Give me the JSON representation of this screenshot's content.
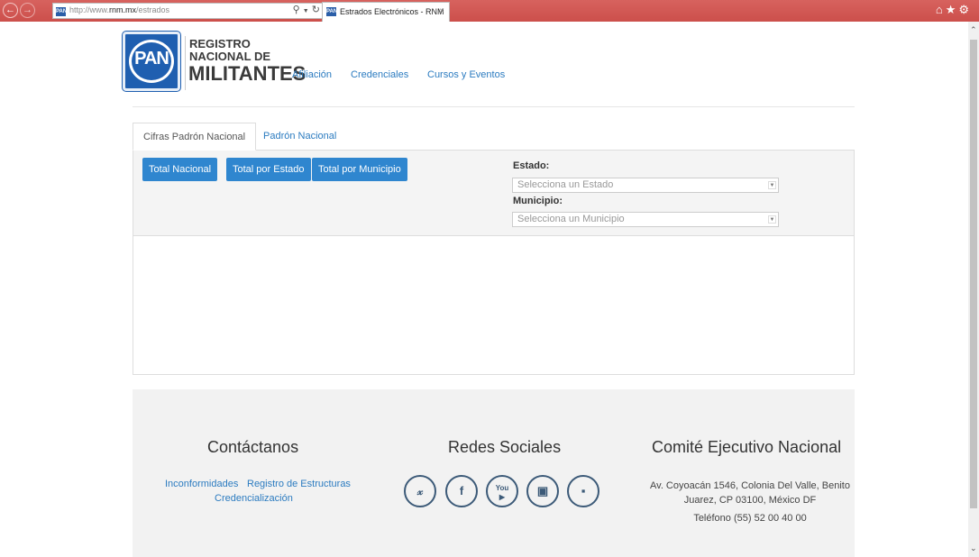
{
  "browser": {
    "url_prefix": "http://www.",
    "url_domain": "rnm.mx",
    "url_path": "/estrados",
    "tab_title": "Estrados Electrónicos - RNM",
    "favicon_text": "PAN"
  },
  "header": {
    "logo_text": "PAN",
    "brand_line1": "REGISTRO",
    "brand_line2": "NACIONAL DE",
    "brand_line3": "MILITANTES",
    "nav": [
      "Afiliación",
      "Credenciales",
      "Cursos y Eventos"
    ]
  },
  "tabs": {
    "active": "Cifras Padrón Nacional",
    "other": "Padrón Nacional"
  },
  "panel": {
    "buttons": [
      "Total Nacional",
      "Total por Estado",
      "Total por Municipio"
    ],
    "estado_label": "Estado:",
    "estado_placeholder": "Selecciona un Estado",
    "municipio_label": "Municipio:",
    "municipio_placeholder": "Selecciona un Municipio"
  },
  "footer": {
    "contact_title": "Contáctanos",
    "contact_links": [
      "Inconformidades",
      "Registro de Estructuras",
      "Credencialización"
    ],
    "social_title": "Redes Sociales",
    "social_icons": [
      "twitter-icon",
      "facebook-icon",
      "youtube-icon",
      "instagram-icon",
      "flickr-icon"
    ],
    "committee_title": "Comité Ejecutivo Nacional",
    "address_line1": "Av. Coyoacán 1546, Colonia Del Valle, Benito",
    "address_line2": "Juarez, CP 03100, México DF",
    "phone": "Teléfono (55) 52 00 40 00"
  },
  "colors": {
    "chrome": "#cc4f4b",
    "accent": "#2f86cf",
    "link": "#2b7bc0"
  }
}
